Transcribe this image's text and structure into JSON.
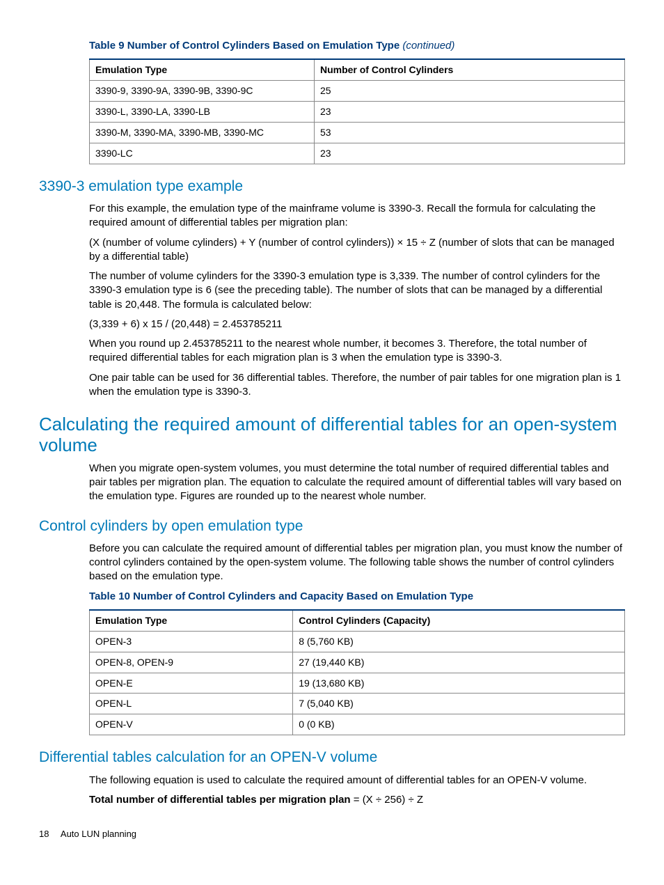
{
  "table9": {
    "caption_prefix": "Table 9 Number of Control Cylinders Based on Emulation Type ",
    "caption_cont": "(continued)",
    "headers": [
      "Emulation Type",
      "Number of Control Cylinders"
    ],
    "rows": [
      [
        "3390-9, 3390-9A, 3390-9B, 3390-9C",
        "25"
      ],
      [
        "3390-L, 3390-LA, 3390-LB",
        "23"
      ],
      [
        "3390-M, 3390-MA, 3390-MB, 3390-MC",
        "53"
      ],
      [
        "3390-LC",
        "23"
      ]
    ]
  },
  "sec1_title": "3390-3 emulation type example",
  "sec1_p1": "For this example, the emulation type of the mainframe volume is 3390-3. Recall the formula for calculating the required amount of differential tables per migration plan:",
  "sec1_p2": "(X (number of volume cylinders) + Y (number of control cylinders)) × 15 ÷ Z (number of slots that can be managed by a differential table)",
  "sec1_p3": "The number of volume cylinders for the 3390-3 emulation type is 3,339. The number of control cylinders for the 3390-3 emulation type is 6 (see the preceding table). The number of slots that can be managed by a differential table is 20,448. The formula is calculated below:",
  "sec1_p4": "(3,339 + 6) x 15 / (20,448) = 2.453785211",
  "sec1_p5": "When you round up 2.453785211 to the nearest whole number, it becomes 3. Therefore, the total number of required differential tables for each migration plan is 3 when the emulation type is 3390-3.",
  "sec1_p6": "One pair table can be used for 36 differential tables. Therefore, the number of pair tables for one migration plan is 1 when the emulation type is 3390-3.",
  "sec2_title": "Calculating the required amount of differential tables for an open-system volume",
  "sec2_p1": "When you migrate open-system volumes, you must determine the total number of required differential tables and pair tables per migration plan. The equation to calculate the required amount of differential tables will vary based on the emulation type. Figures are rounded up to the nearest whole number.",
  "sec3_title": "Control cylinders by open emulation type",
  "sec3_p1": "Before you can calculate the required amount of differential tables per migration plan, you must know the number of control cylinders contained by the open-system volume. The following table shows the number of control cylinders based on the emulation type.",
  "table10": {
    "caption": "Table 10 Number of Control Cylinders and Capacity Based on Emulation Type",
    "headers": [
      "Emulation Type",
      "Control Cylinders (Capacity)"
    ],
    "rows": [
      [
        "OPEN-3",
        "8 (5,760 KB)"
      ],
      [
        "OPEN-8, OPEN-9",
        "27 (19,440 KB)"
      ],
      [
        "OPEN-E",
        "19 (13,680 KB)"
      ],
      [
        "OPEN-L",
        "7 (5,040 KB)"
      ],
      [
        "OPEN-V",
        "0 (0 KB)"
      ]
    ]
  },
  "sec4_title": "Differential tables calculation for an OPEN-V volume",
  "sec4_p1": "The following equation is used to calculate the required amount of differential tables for an OPEN-V volume.",
  "sec4_eq_bold": "Total number of differential tables per migration plan",
  "sec4_eq_rest": " = (X ÷ 256) ÷ Z",
  "footer_page": "18",
  "footer_text": "Auto LUN planning"
}
